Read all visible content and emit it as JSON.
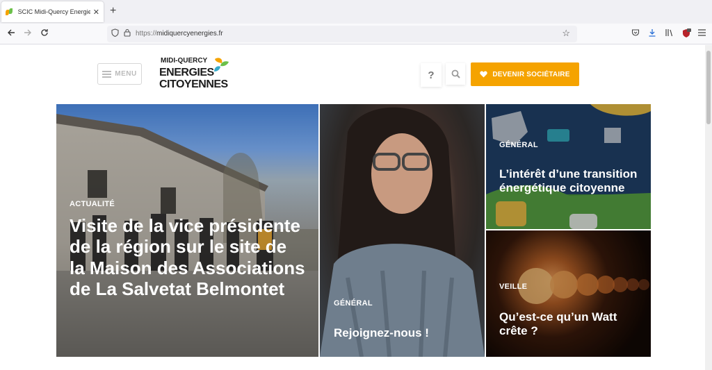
{
  "browser": {
    "tab_title": "SCIC Midi-Quercy Energies Citoyennes",
    "tab_close": "✕",
    "new_tab": "+",
    "url_scheme": "https://",
    "url_host": "midiquercyenergies.fr",
    "icons": [
      "back-icon",
      "forward-icon",
      "reload-icon",
      "shield-icon",
      "lock-icon",
      "star-icon",
      "pocket-icon",
      "download-icon",
      "library-icon",
      "extension-icon",
      "menu-icon"
    ]
  },
  "header": {
    "menu_label": "MENU",
    "logo": {
      "line1": "MIDI-QUERCY",
      "line2": "ENERGIES",
      "line3": "CITOYENNES"
    },
    "help_label": "?",
    "cta_label": "DEVENIR SOCIÉTAIRE"
  },
  "articles": [
    {
      "category": "ACTUALITÉ",
      "title": "Visite de la vice présidente de la région sur le site de la Maison des Associations de La Salvetat Belmontet"
    },
    {
      "category": "GÉNÉRAL",
      "title": "Rejoignez-nous !"
    },
    {
      "category": "GÉNÉRAL",
      "title": "L’intérêt d’une transition énergétique citoyenne"
    },
    {
      "category": "VEILLE",
      "title": "Qu’est-ce qu’un Watt crête ?"
    }
  ],
  "colors": {
    "accent": "#f5a300",
    "logo_text": "#1c1c1c",
    "menu_text": "#bbbbbb"
  }
}
